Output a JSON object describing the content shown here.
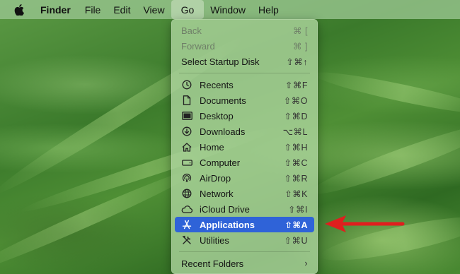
{
  "menubar": {
    "apple_icon": "apple-logo-icon",
    "items": [
      "Finder",
      "File",
      "Edit",
      "View",
      "Go",
      "Window",
      "Help"
    ]
  },
  "menu": {
    "back": {
      "label": "Back",
      "shortcut": "⌘ ["
    },
    "forward": {
      "label": "Forward",
      "shortcut": "⌘ ]"
    },
    "startup": {
      "label": "Select Startup Disk",
      "shortcut": "⇧⌘↑"
    },
    "places": [
      {
        "label": "Recents",
        "shortcut": "⇧⌘F",
        "icon": "clock-icon"
      },
      {
        "label": "Documents",
        "shortcut": "⇧⌘O",
        "icon": "document-icon"
      },
      {
        "label": "Desktop",
        "shortcut": "⇧⌘D",
        "icon": "desktop-icon"
      },
      {
        "label": "Downloads",
        "shortcut": "⌥⌘L",
        "icon": "download-icon"
      },
      {
        "label": "Home",
        "shortcut": "⇧⌘H",
        "icon": "home-icon"
      },
      {
        "label": "Computer",
        "shortcut": "⇧⌘C",
        "icon": "computer-icon"
      },
      {
        "label": "AirDrop",
        "shortcut": "⇧⌘R",
        "icon": "airdrop-icon"
      },
      {
        "label": "Network",
        "shortcut": "⇧⌘K",
        "icon": "network-icon"
      },
      {
        "label": "iCloud Drive",
        "shortcut": "⇧⌘I",
        "icon": "cloud-icon"
      },
      {
        "label": "Applications",
        "shortcut": "⇧⌘A",
        "icon": "applications-icon"
      },
      {
        "label": "Utilities",
        "shortcut": "⇧⌘U",
        "icon": "utilities-icon"
      }
    ],
    "recent_folders": {
      "label": "Recent Folders",
      "shortcut": "›"
    }
  },
  "colors": {
    "highlight": "#2f63d8",
    "arrow": "#e01e1e"
  }
}
